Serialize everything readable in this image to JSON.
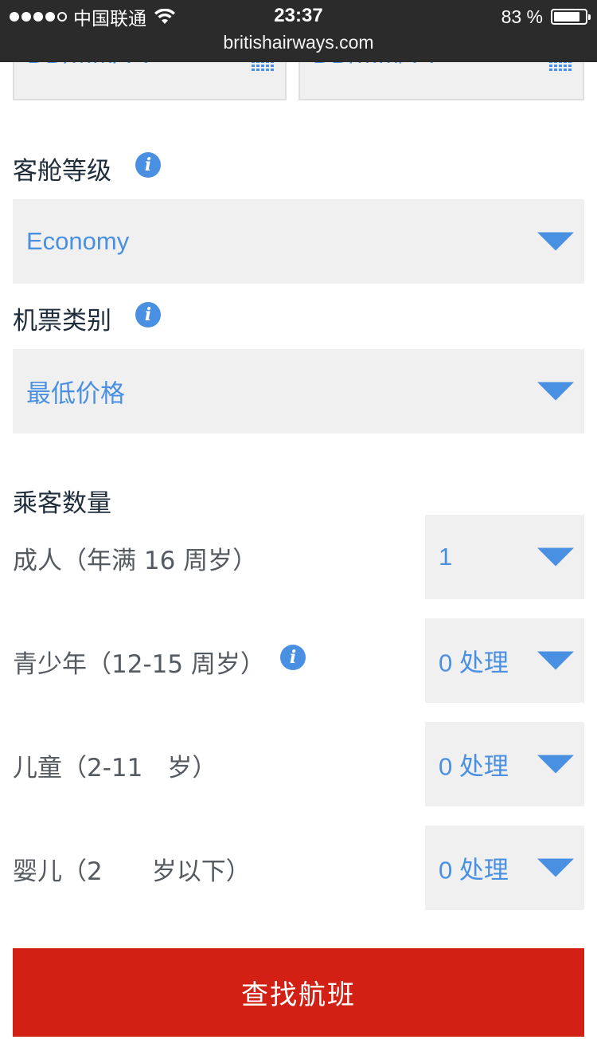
{
  "status_bar": {
    "signal_dots_filled": 4,
    "signal_dots_total": 5,
    "carrier": "中国联通",
    "time": "23:37",
    "battery_text": "83 %",
    "battery_level_percent": 83,
    "url": "britishairways.com",
    "icons": [
      "wifi-icon",
      "battery-icon"
    ]
  },
  "dates": {
    "outbound_placeholder": "DD/MM/YY",
    "return_placeholder": "DD/MM/YY",
    "icon": "calendar-icon"
  },
  "cabin": {
    "label": "客舱等级",
    "value": "Economy",
    "icon": "info-icon"
  },
  "ticket": {
    "label": "机票类别",
    "value": "最低价格",
    "icon": "info-icon"
  },
  "passengers": {
    "heading": "乘客数量",
    "adults": {
      "label": "成人（年满 16 周岁）",
      "value": "1"
    },
    "youth": {
      "label": "青少年（12-15 周岁）",
      "value": "0 处理"
    },
    "children": {
      "label": "儿童（2-11　岁）",
      "value": "0 处理"
    },
    "infants": {
      "label": "婴儿（2　　岁以下）",
      "value": "0 处理"
    }
  },
  "search_button": {
    "label": "查找航班"
  },
  "colors": {
    "accent": "#4a90e2",
    "button": "#d22014",
    "field_bg": "#f0f0f0",
    "status_bar_bg": "#2b2b2b"
  }
}
